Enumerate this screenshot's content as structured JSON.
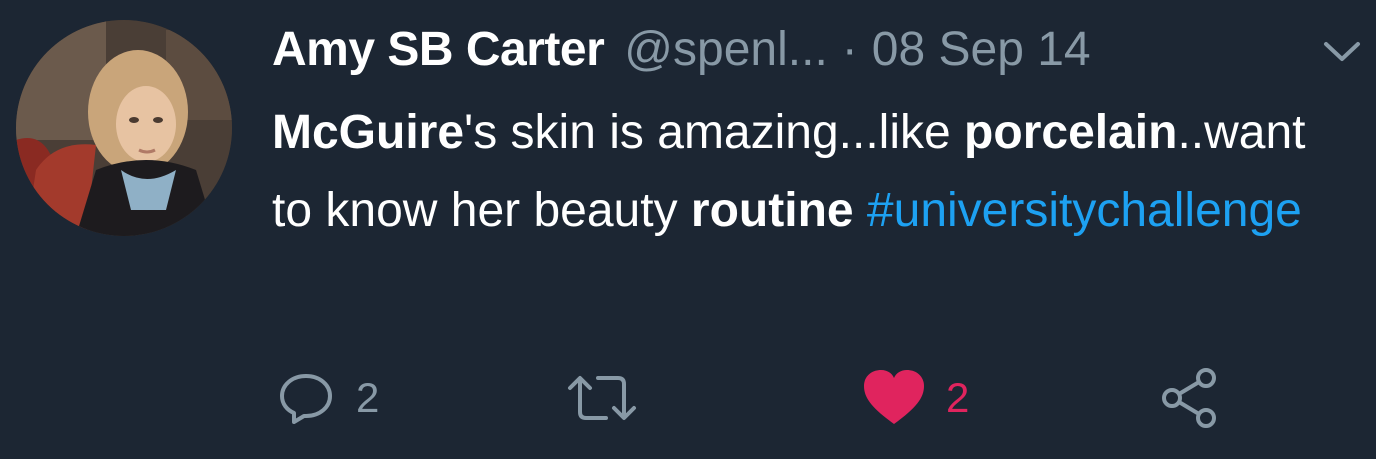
{
  "tweet": {
    "display_name": "Amy SB Carter",
    "handle": "@spenl...",
    "separator": "·",
    "date": "08 Sep 14",
    "body": [
      {
        "text": "McGuire",
        "style": "bold"
      },
      {
        "text": "'s skin is amazing...like ",
        "style": "plain"
      },
      {
        "text": "porcelain",
        "style": "bold"
      },
      {
        "text": "..want to know her beauty ",
        "style": "plain"
      },
      {
        "text": "routine",
        "style": "bold"
      },
      {
        "text": " ",
        "style": "plain"
      },
      {
        "text": "#universitychallenge",
        "style": "hashtag"
      }
    ]
  },
  "actions": {
    "reply_count": "2",
    "like_count": "2"
  },
  "icons": {
    "menu": "chevron-down-icon",
    "reply": "reply-icon",
    "retweet": "retweet-icon",
    "like": "heart-icon",
    "share": "share-icon"
  },
  "colors": {
    "background": "#1c2633",
    "text": "#ffffff",
    "muted": "#8899a6",
    "link": "#1da1f2",
    "like": "#e0245e"
  }
}
